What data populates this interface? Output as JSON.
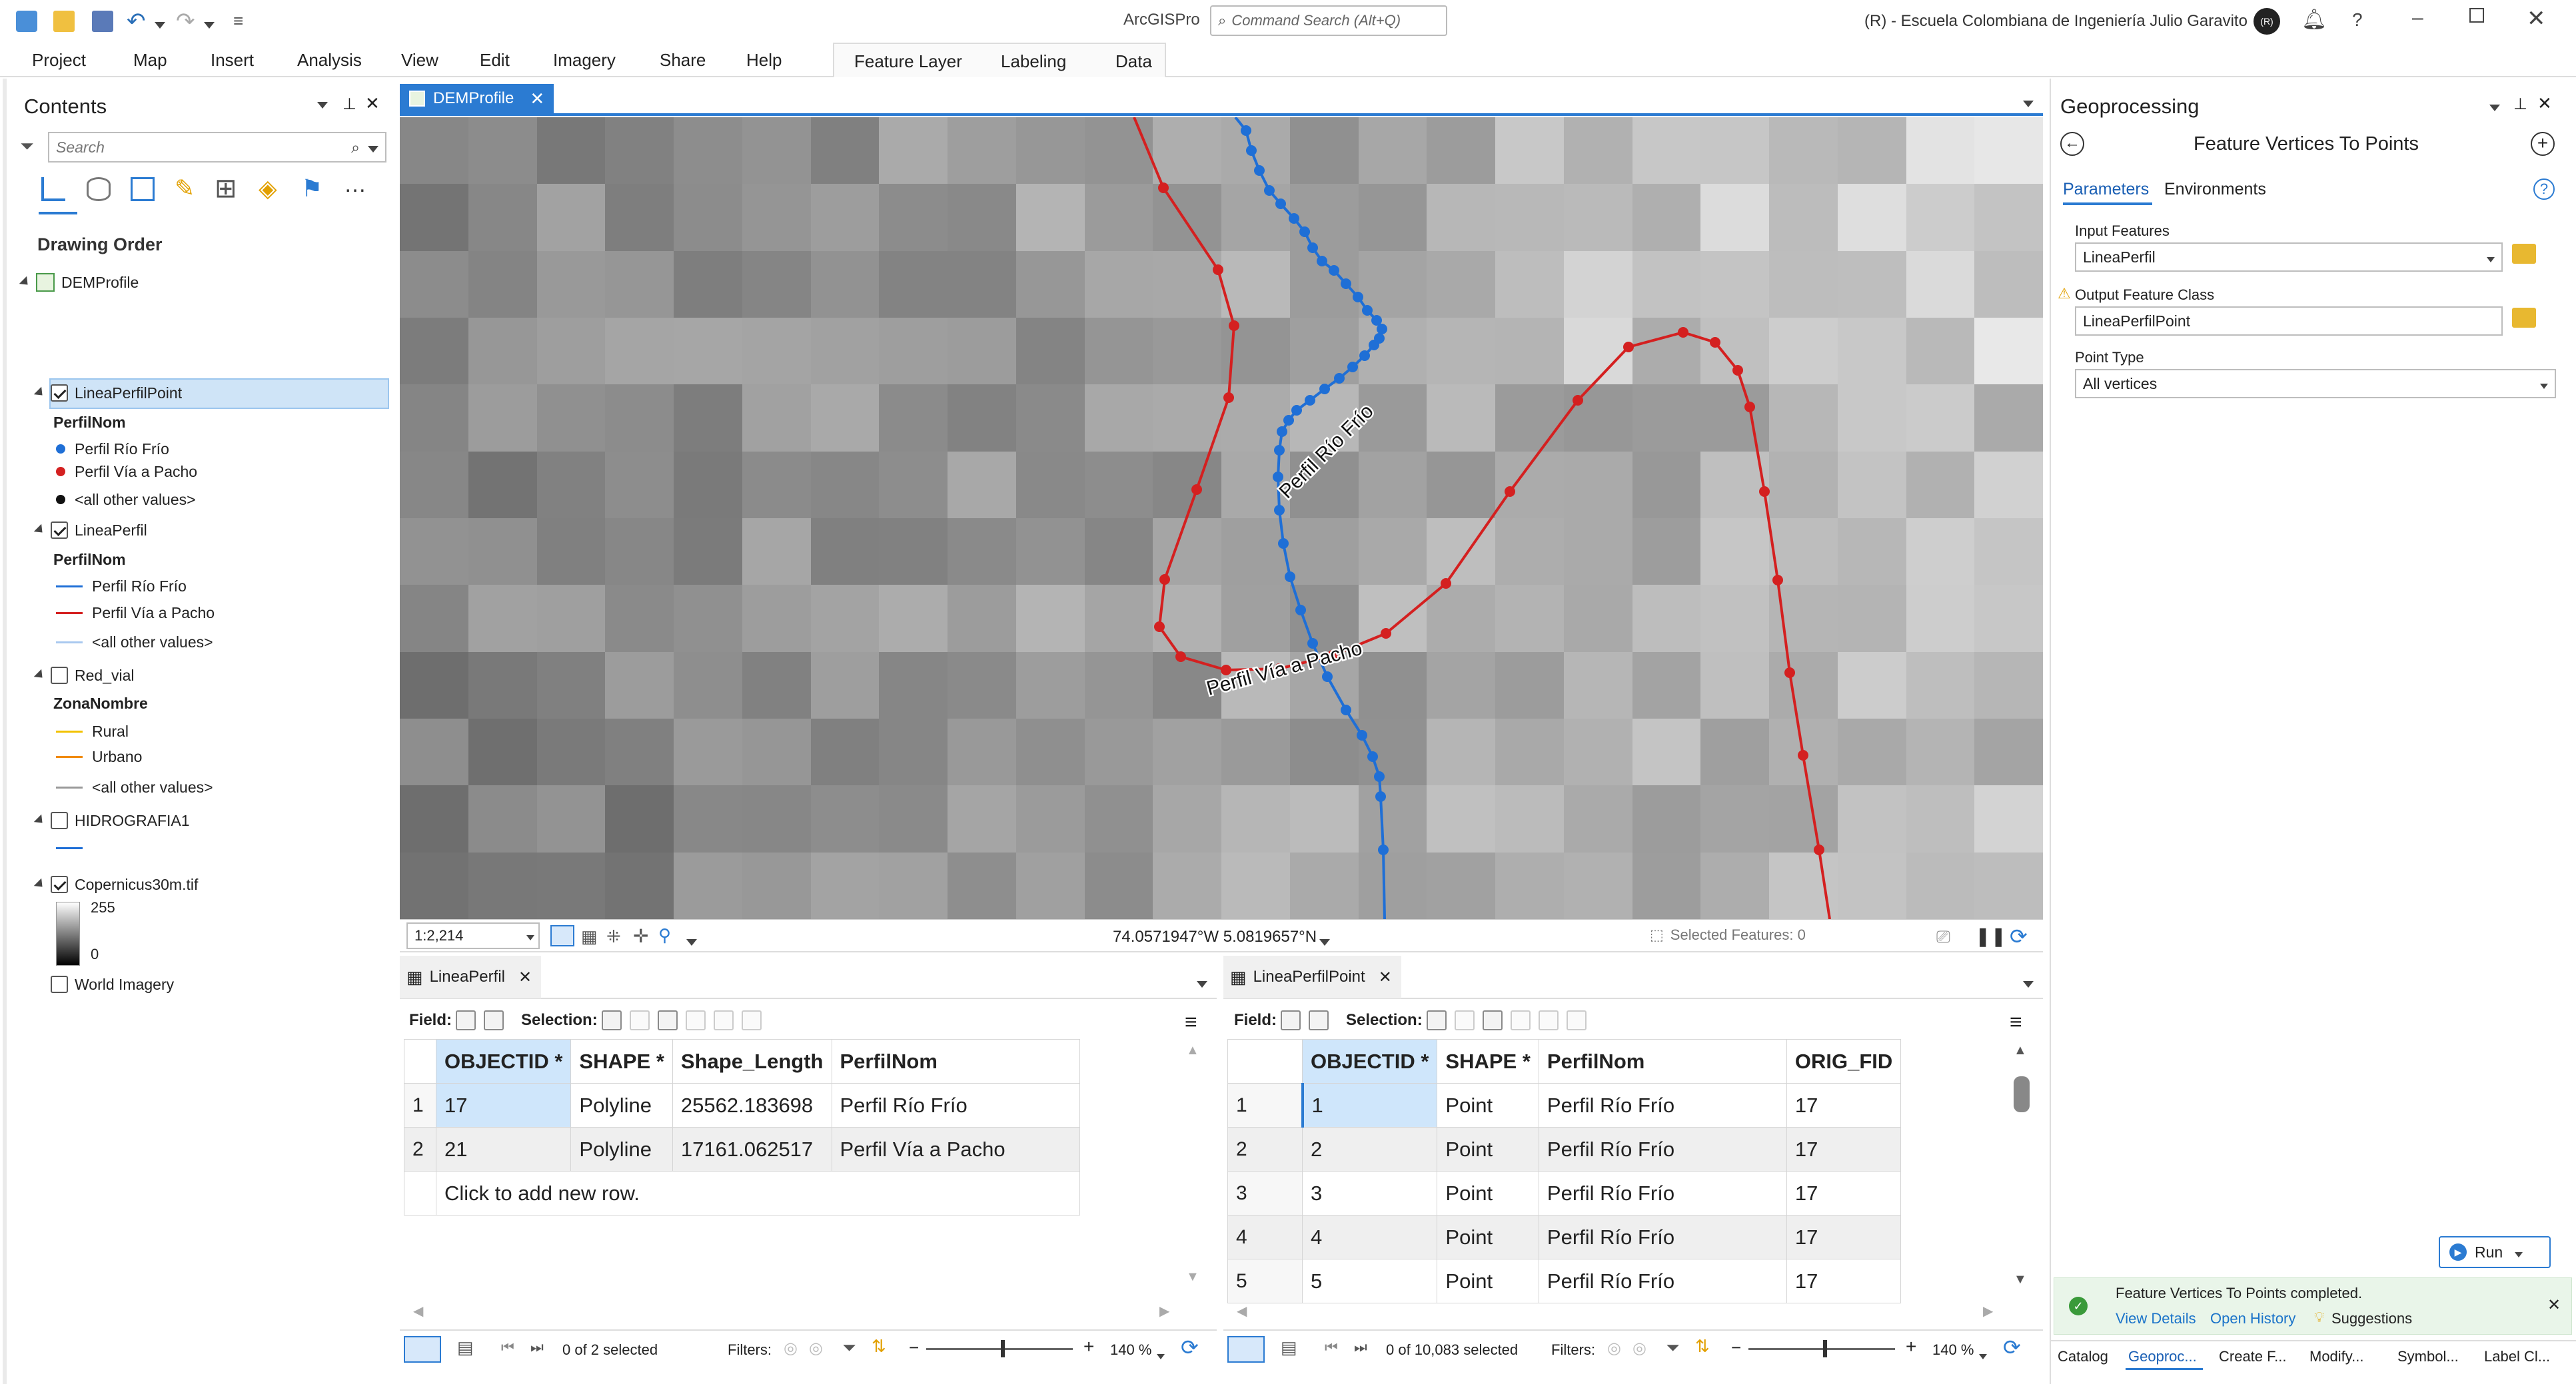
{
  "app": {
    "name": "ArcGISPro",
    "search_placeholder": "Command Search (Alt+Q)",
    "account": "(R) - Escuela Colombiana de Ingeniería Julio Garavito",
    "avatar_initials": "(R)"
  },
  "ribbon": {
    "tabs": [
      "Project",
      "Map",
      "Insert",
      "Analysis",
      "View",
      "Edit",
      "Imagery",
      "Share",
      "Help"
    ],
    "context_tabs": [
      "Feature Layer",
      "Labeling",
      "Data"
    ]
  },
  "contents": {
    "title": "Contents",
    "search_placeholder": "Search",
    "section": "Drawing Order",
    "map_name": "DEMProfile",
    "layers": {
      "point_layer": "LineaPerfilPoint",
      "point_field": "PerfilNom",
      "point_items": [
        "Perfil Río Frío",
        "Perfil Vía a Pacho",
        "<all other values>"
      ],
      "line_layer": "LineaPerfil",
      "line_field": "PerfilNom",
      "line_items": [
        "Perfil Río Frío",
        "Perfil Vía a Pacho",
        "<all other values>"
      ],
      "road_layer": "Red_vial",
      "road_field": "ZonaNombre",
      "road_items": [
        "Rural",
        "Urbano",
        "<all other values>"
      ],
      "hydro_layer": "HIDROGRAFIA1",
      "raster_layer": "Copernicus30m.tif",
      "raster_max": "255",
      "raster_min": "0",
      "basemap": "World Imagery"
    },
    "colors": {
      "blue": "#1f6fd6",
      "red": "#d42020",
      "yellow": "#f2c200",
      "orange": "#f08a00",
      "gray": "#999999"
    }
  },
  "map_view": {
    "tab": "DEMProfile",
    "scale": "1:2,214",
    "coordinates": "74.0571947°W 5.0819657°N",
    "selected_features": "Selected Features: 0",
    "labels": {
      "river": "Perfil Río Frío",
      "road": "Perfil Vía a Pacho"
    }
  },
  "table_left": {
    "tab": "LineaPerfil",
    "field_label": "Field:",
    "selection_label": "Selection:",
    "columns": [
      "OBJECTID *",
      "SHAPE *",
      "Shape_Length",
      "PerfilNom"
    ],
    "rows": [
      {
        "n": "1",
        "oid": "17",
        "shape": "Polyline",
        "length": "25562.183698",
        "name": "Perfil Río Frío"
      },
      {
        "n": "2",
        "oid": "21",
        "shape": "Polyline",
        "length": "17161.062517",
        "name": "Perfil Vía a Pacho"
      }
    ],
    "add_row": "Click to add new row.",
    "status": "0 of 2 selected",
    "filters": "Filters:",
    "zoom": "140 %"
  },
  "table_right": {
    "tab": "LineaPerfilPoint",
    "field_label": "Field:",
    "selection_label": "Selection:",
    "columns": [
      "OBJECTID *",
      "SHAPE *",
      "PerfilNom",
      "ORIG_FID"
    ],
    "rows": [
      {
        "n": "1",
        "oid": "1",
        "shape": "Point",
        "name": "Perfil Río Frío",
        "fid": "17"
      },
      {
        "n": "2",
        "oid": "2",
        "shape": "Point",
        "name": "Perfil Río Frío",
        "fid": "17"
      },
      {
        "n": "3",
        "oid": "3",
        "shape": "Point",
        "name": "Perfil Río Frío",
        "fid": "17"
      },
      {
        "n": "4",
        "oid": "4",
        "shape": "Point",
        "name": "Perfil Río Frío",
        "fid": "17"
      },
      {
        "n": "5",
        "oid": "5",
        "shape": "Point",
        "name": "Perfil Río Frío",
        "fid": "17"
      }
    ],
    "status": "0 of 10,083 selected",
    "filters": "Filters:",
    "zoom": "140 %"
  },
  "geoprocessing": {
    "title": "Geoprocessing",
    "tool": "Feature Vertices To Points",
    "tabs": [
      "Parameters",
      "Environments"
    ],
    "input_label": "Input Features",
    "input_value": "LineaPerfil",
    "output_label": "Output Feature Class",
    "output_value": "LineaPerfilPoint",
    "type_label": "Point Type",
    "type_value": "All vertices",
    "run": "Run",
    "message": "Feature Vertices To Points completed.",
    "links": [
      "View Details",
      "Open History",
      "Suggestions"
    ]
  },
  "bottom_tabs": [
    "Catalog",
    "Geoproc...",
    "Create F...",
    "Modify...",
    "Symbol...",
    "Label Cl..."
  ]
}
